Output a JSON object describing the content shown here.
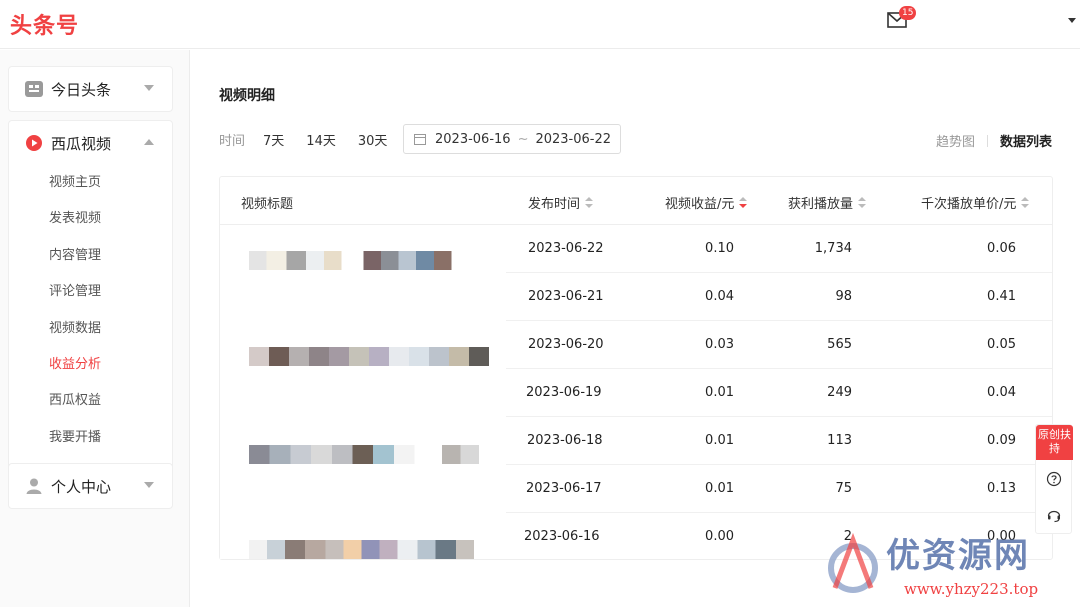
{
  "header": {
    "logo": "头条号",
    "mail_badge": "15"
  },
  "sidebar": {
    "groups": [
      {
        "label": "今日头条",
        "expanded": false
      },
      {
        "label": "西瓜视频",
        "expanded": true,
        "items": [
          "视频主页",
          "发表视频",
          "内容管理",
          "评论管理",
          "视频数据",
          "收益分析",
          "西瓜权益",
          "我要开播"
        ],
        "active": "收益分析"
      },
      {
        "label": "个人中心",
        "expanded": false
      }
    ]
  },
  "main": {
    "title": "视频明细",
    "filter_label": "时间",
    "range_options": [
      "7天",
      "14天",
      "30天"
    ],
    "date_start": "2023-06-16",
    "date_sep": "~",
    "date_end": "2023-06-22",
    "view_trend": "趋势图",
    "view_list": "数据列表",
    "columns": [
      "视频标题",
      "发布时间",
      "视频收益/元",
      "获利播放量",
      "千次播放单价/元"
    ],
    "rows": [
      {
        "date": "2023-06-22",
        "income": "0.10",
        "plays": "1,734",
        "cpm": "0.06"
      },
      {
        "date": "2023-06-21",
        "income": "0.04",
        "plays": "98",
        "cpm": "0.41"
      },
      {
        "date": "2023-06-20",
        "income": "0.03",
        "plays": "565",
        "cpm": "0.05"
      },
      {
        "date": "2023-06-19",
        "income": "0.01",
        "plays": "249",
        "cpm": "0.04"
      },
      {
        "date": "2023-06-18",
        "income": "0.01",
        "plays": "113",
        "cpm": "0.09"
      },
      {
        "date": "2023-06-17",
        "income": "0.01",
        "plays": "75",
        "cpm": "0.13"
      },
      {
        "date": "2023-06-16",
        "income": "0.00",
        "plays": "2",
        "cpm": "0.00"
      }
    ]
  },
  "float": {
    "original": "原创扶持"
  },
  "watermark": {
    "text": "优资源网",
    "url": "www.yhzy223.top"
  },
  "colors": {
    "accent": "#f04142"
  },
  "icons": [
    "mail-icon",
    "help-icon",
    "headset-icon",
    "calendar-icon"
  ]
}
